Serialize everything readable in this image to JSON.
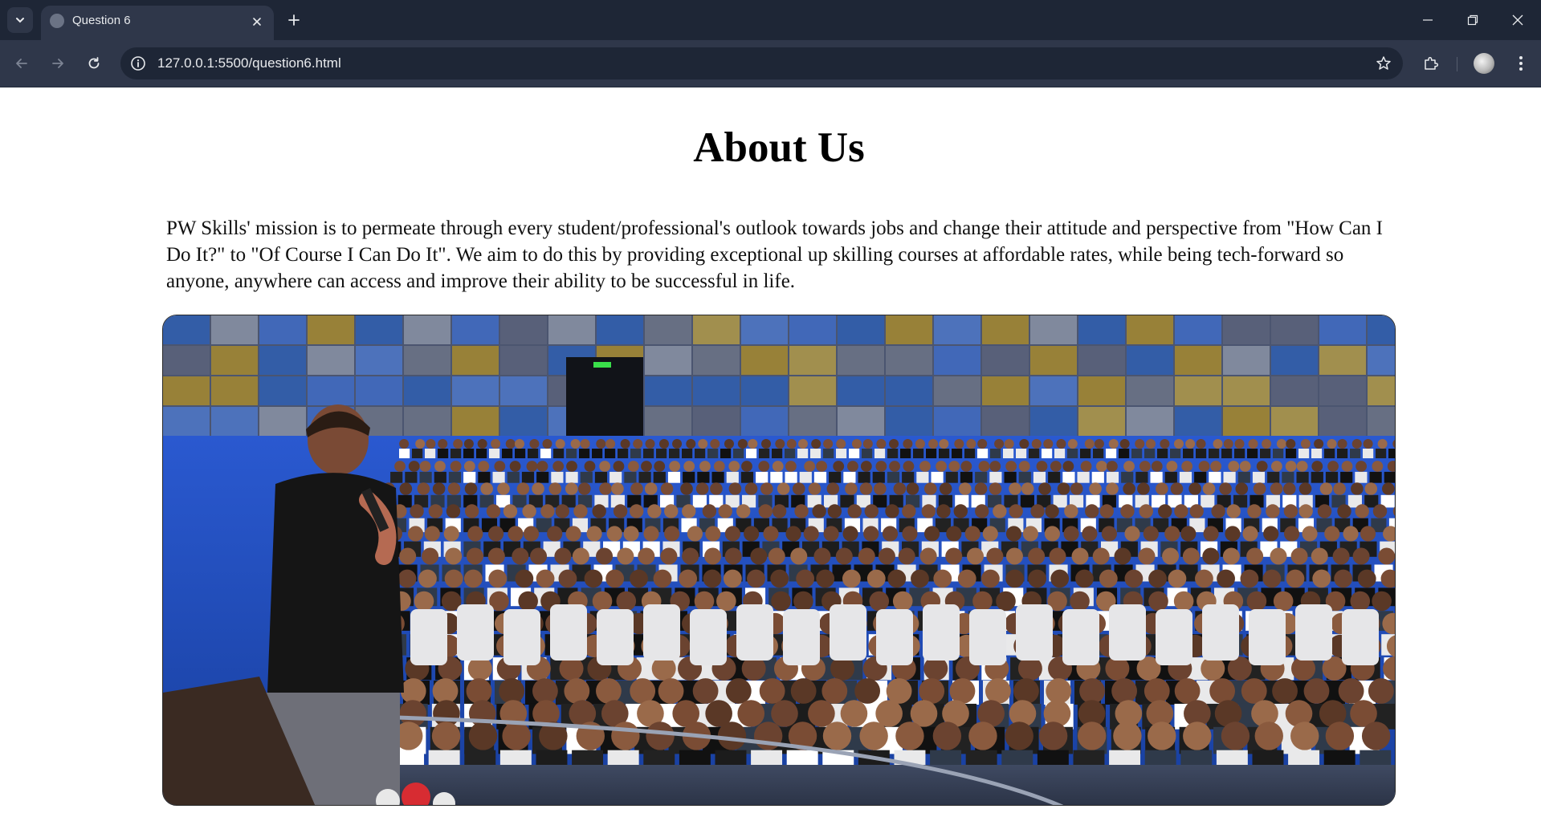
{
  "browser": {
    "tab_title": "Question 6",
    "url": "127.0.0.1:5500/question6.html"
  },
  "page": {
    "heading": "About Us",
    "mission_text": "PW Skills' mission is to permeate through every student/professional's outlook towards jobs and change their attitude and perspective from \"How Can I Do It?\" to \"Of Course I Can Do It\". We aim to do this by providing exceptional up skilling courses at affordable rates, while being tech-forward so anyone, anywhere can access and improve their ability to be successful in life."
  },
  "icons": {
    "tab_menu": "chevron-down-icon",
    "favicon": "globe-icon",
    "tab_close": "close-icon",
    "new_tab": "plus-icon",
    "back": "arrow-left-icon",
    "forward": "arrow-right-icon",
    "reload": "reload-icon",
    "site_info": "info-icon",
    "bookmark": "star-icon",
    "extensions": "puzzle-icon",
    "profile": "avatar-icon",
    "menu": "kebab-menu-icon"
  },
  "colors": {
    "tabbar_bg": "#1e2636",
    "toolbar_bg": "#2f374a",
    "seat_blue": "#1e4fc4",
    "page_bg": "#ffffff"
  }
}
